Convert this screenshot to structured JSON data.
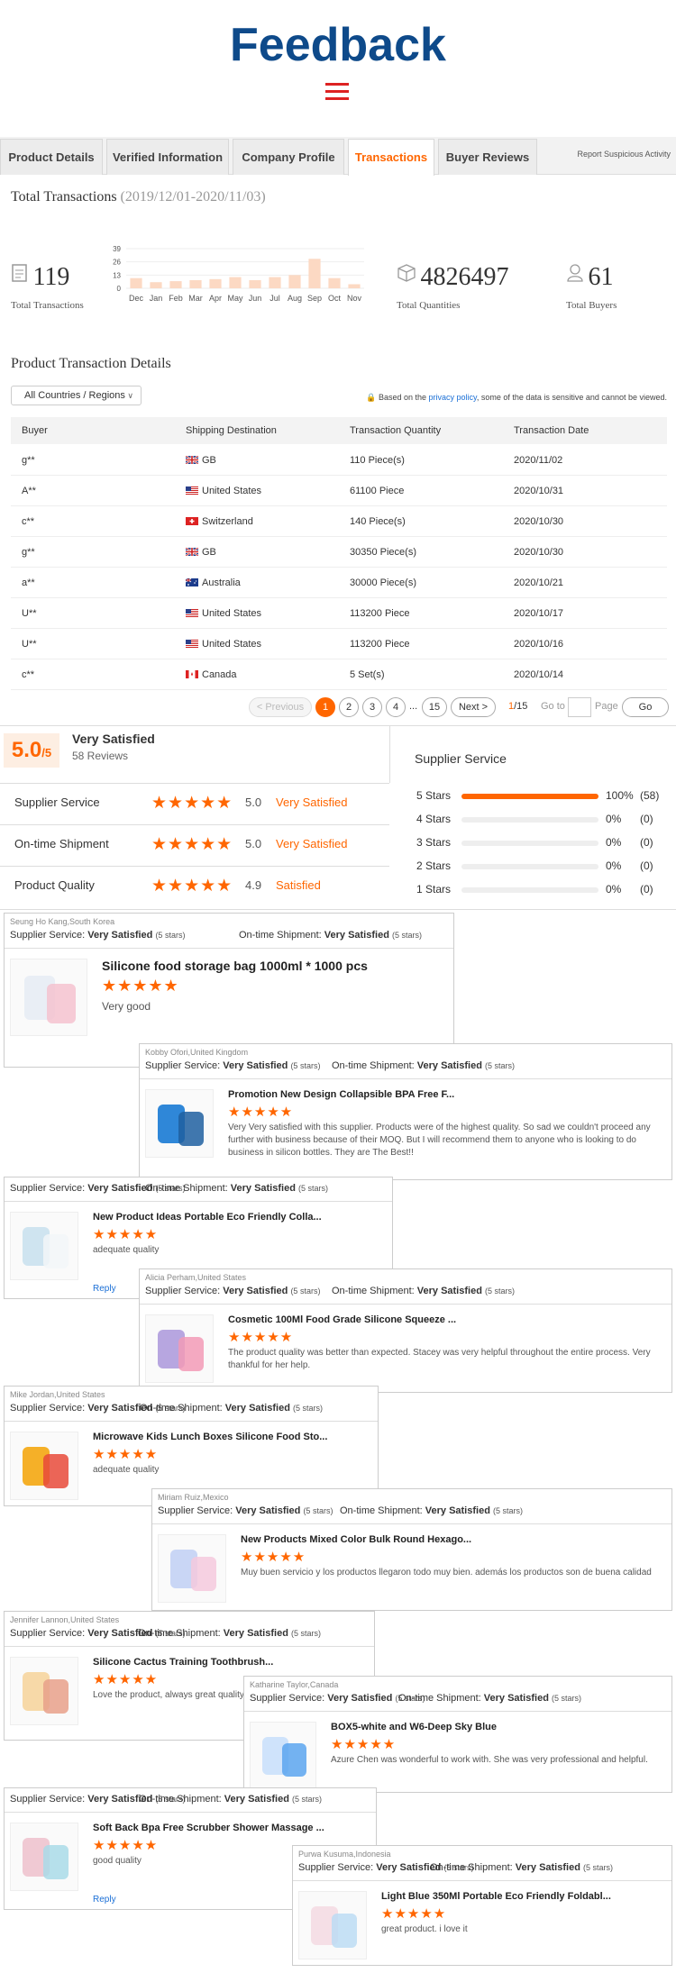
{
  "header": {
    "title": "Feedback",
    "menu_icon": "hamburger-menu-icon"
  },
  "tabs": [
    {
      "label": "Product Details"
    },
    {
      "label": "Verified Information"
    },
    {
      "label": "Company Profile"
    },
    {
      "label": "Transactions",
      "active": true
    },
    {
      "label": "Buyer Reviews"
    }
  ],
  "report_link": "Report Suspicious Activity",
  "transactions": {
    "title": "Total Transactions",
    "date_range": "(2019/12/01-2020/11/03)",
    "total_transactions": "119",
    "total_transactions_label": "Total Transactions",
    "total_quantities": "4826497",
    "total_quantities_label": "Total Quantities",
    "total_buyers": "61",
    "total_buyers_label": "Total Buyers"
  },
  "chart_data": {
    "type": "bar",
    "categories": [
      "Dec",
      "Jan",
      "Feb",
      "Mar",
      "Apr",
      "May",
      "Jun",
      "Jul",
      "Aug",
      "Sep",
      "Oct",
      "Nov"
    ],
    "values": [
      10,
      6,
      7,
      8,
      9,
      11,
      8,
      11,
      13,
      29,
      10,
      4
    ],
    "yticks": [
      "39",
      "26",
      "13",
      "0"
    ],
    "ylim": [
      0,
      39
    ],
    "grid": true,
    "bar_color": "#fcd9c3"
  },
  "details": {
    "title": "Product Transaction Details",
    "filter": "All Countries / Regions",
    "policy_prefix": "Based on the",
    "policy_link": "privacy policy",
    "policy_suffix": ", some of the data is sensitive and cannot be viewed.",
    "columns": [
      "Buyer",
      "Shipping Destination",
      "Transaction Quantity",
      "Transaction Date"
    ],
    "rows": [
      {
        "buyer": "g**",
        "flag": "GB",
        "dest": "GB",
        "qty": "110 Piece(s)",
        "date": "2020/11/02"
      },
      {
        "buyer": "A**",
        "flag": "US",
        "dest": "United States",
        "qty": "61100 Piece",
        "date": "2020/10/31"
      },
      {
        "buyer": "c**",
        "flag": "CH",
        "dest": "Switzerland",
        "qty": "140 Piece(s)",
        "date": "2020/10/30"
      },
      {
        "buyer": "g**",
        "flag": "GB",
        "dest": "GB",
        "qty": "30350 Piece(s)",
        "date": "2020/10/30"
      },
      {
        "buyer": "a**",
        "flag": "AU",
        "dest": "Australia",
        "qty": "30000 Piece(s)",
        "date": "2020/10/21"
      },
      {
        "buyer": "U**",
        "flag": "US",
        "dest": "United States",
        "qty": "113200 Piece",
        "date": "2020/10/17"
      },
      {
        "buyer": "U**",
        "flag": "US",
        "dest": "United States",
        "qty": "113200 Piece",
        "date": "2020/10/16"
      },
      {
        "buyer": "c**",
        "flag": "CA",
        "dest": "Canada",
        "qty": "5 Set(s)",
        "date": "2020/10/14"
      }
    ]
  },
  "pager": {
    "prev": "< Previous",
    "pages": [
      "1",
      "2",
      "3",
      "4"
    ],
    "ellipsis": "...",
    "last": "15",
    "next": "Next >",
    "current": "1",
    "total": "/15",
    "goto": "Go to",
    "page": "Page",
    "go": "Go"
  },
  "ratings": {
    "score": "5.0",
    "score_out_of": "/5",
    "label": "Very Satisfied",
    "count": "58 Reviews",
    "categories": [
      {
        "name": "Supplier Service",
        "score": "5.0",
        "text": "Very Satisfied"
      },
      {
        "name": "On-time Shipment",
        "score": "5.0",
        "text": "Very Satisfied"
      },
      {
        "name": "Product Quality",
        "score": "4.9",
        "text": "Satisfied"
      }
    ],
    "supplier_service_title": "Supplier Service",
    "breakdown": [
      {
        "label": "5 Stars",
        "pct": "100%",
        "count": "(58)",
        "fill": 1.0
      },
      {
        "label": "4 Stars",
        "pct": "0%",
        "count": "(0)",
        "fill": 0
      },
      {
        "label": "3 Stars",
        "pct": "0%",
        "count": "(0)",
        "fill": 0
      },
      {
        "label": "2 Stars",
        "pct": "0%",
        "count": "(0)",
        "fill": 0
      },
      {
        "label": "1 Stars",
        "pct": "0%",
        "count": "(0)",
        "fill": 0
      }
    ]
  },
  "review_labels": {
    "supplier_service": "Supplier Service:",
    "ontime": "On-time Shipment:",
    "very_satisfied": "Very Satisfied",
    "five_stars": "(5 stars)",
    "reply": "Reply"
  },
  "reviews": [
    {
      "reviewer": "Seung Ho Kang,South Korea",
      "product": "Silicone food storage bag 1000ml * 1000 pcs",
      "text": "Very good"
    },
    {
      "reviewer": "Kobby Ofori,United Kingdom",
      "product": "Promotion New Design Collapsible BPA Free F...",
      "text": "Very Very satisfied with this supplier. Products were of the highest quality. So sad we couldn't proceed any further with business because of their MOQ. But I will recommend them to anyone who is looking to do business in silicon bottles. They are The Best!!"
    },
    {
      "reviewer": "",
      "product": "New Product Ideas Portable Eco Friendly Colla...",
      "text": "adequate quality"
    },
    {
      "reviewer": "Alicia Perham,United States",
      "product": "Cosmetic 100Ml Food Grade Silicone Squeeze ...",
      "text": "The product quality was better than expected.  Stacey was very helpful throughout the entire process.  Very thankful for her help."
    },
    {
      "reviewer": "Mike Jordan,United States",
      "product": "Microwave Kids Lunch Boxes Silicone Food Sto...",
      "text": "adequate quality"
    },
    {
      "reviewer": "Miriam Ruiz,Mexico",
      "product": "New Products Mixed Color Bulk Round Hexago...",
      "text": "Muy buen servicio y los productos llegaron todo muy bien. además los productos son de buena calidad"
    },
    {
      "reviewer": "Jennifer Lannon,United States",
      "product": "Silicone Cactus Training Toothbrush...",
      "text": "Love the product, always great quality"
    },
    {
      "reviewer": "Katharine Taylor,Canada",
      "product": "BOX5-white and W6-Deep Sky Blue",
      "text": "Azure Chen was wonderful to work with. She was very professional and helpful."
    },
    {
      "reviewer": "",
      "product": "Soft Back Bpa Free Scrubber Shower Massage ...",
      "text": "good quality"
    },
    {
      "reviewer": "Purwa Kusuma,Indonesia",
      "product": "Light Blue 350Ml Portable Eco Friendly Foldabl...",
      "text": "great product. i love it"
    }
  ]
}
